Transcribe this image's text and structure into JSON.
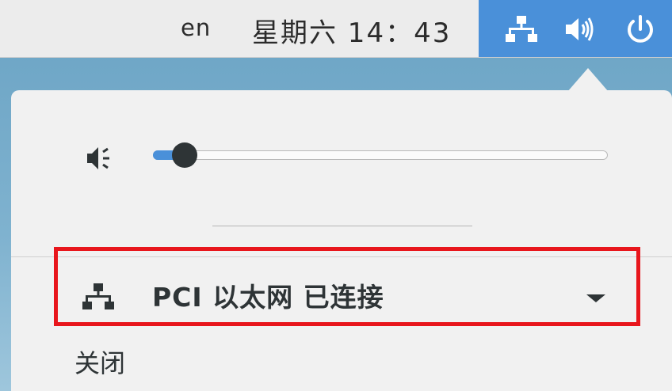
{
  "topbar": {
    "keyboard_layout": "en",
    "clock": "星期六 14：43",
    "status_icons": [
      "network-wired-icon",
      "volume-icon",
      "power-icon"
    ]
  },
  "popover": {
    "volume": {
      "icon": "volume-low-icon",
      "level": 0.07
    },
    "network": {
      "icon": "network-wired-icon",
      "label": "PCI 以太网  已连接",
      "expand_icon": "triangle-down-icon"
    },
    "turn_off_label": "关闭"
  },
  "colors": {
    "accent": "#4a90d9",
    "highlight": "#e8161c",
    "panel_bg": "#f1f1f1",
    "text": "#2e3436"
  }
}
